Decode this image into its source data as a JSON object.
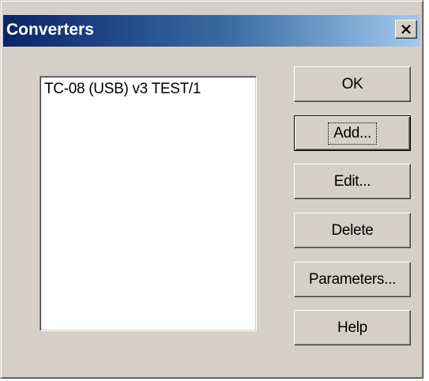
{
  "window": {
    "title": "Converters"
  },
  "titlebar": {
    "close_icon": "close-icon"
  },
  "converter_list": {
    "items": [
      "TC-08 (USB) v3 TEST/1"
    ]
  },
  "buttons": {
    "ok": "OK",
    "add": "Add...",
    "edit": "Edit...",
    "delete": "Delete",
    "parameters": "Parameters...",
    "help": "Help"
  },
  "colors": {
    "face": "#d4d0c8",
    "title_start": "#0a246a",
    "title_end": "#a6caf0"
  }
}
